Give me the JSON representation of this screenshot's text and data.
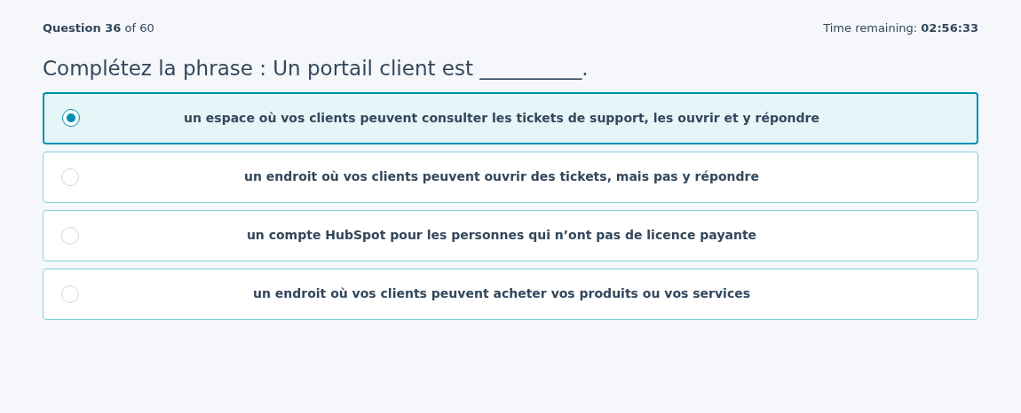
{
  "progress": "**Question 36** of 60",
  "timer": "Time remaining: **02:56:33**",
  "question": "Complétez la phrase : Un portail client est __________.",
  "options": [
    {
      "label": "un espace où vos clients peuvent consulter les tickets de support, les ouvrir et y répondre",
      "selected": true
    },
    {
      "label": "un endroit où vos clients peuvent ouvrir des tickets, mais pas y répondre",
      "selected": false
    },
    {
      "label": "un compte HubSpot pour les personnes qui n’ont pas de licence payante",
      "selected": false
    },
    {
      "label": "un endroit où vos clients peuvent acheter vos produits ou vos services",
      "selected": false
    }
  ]
}
